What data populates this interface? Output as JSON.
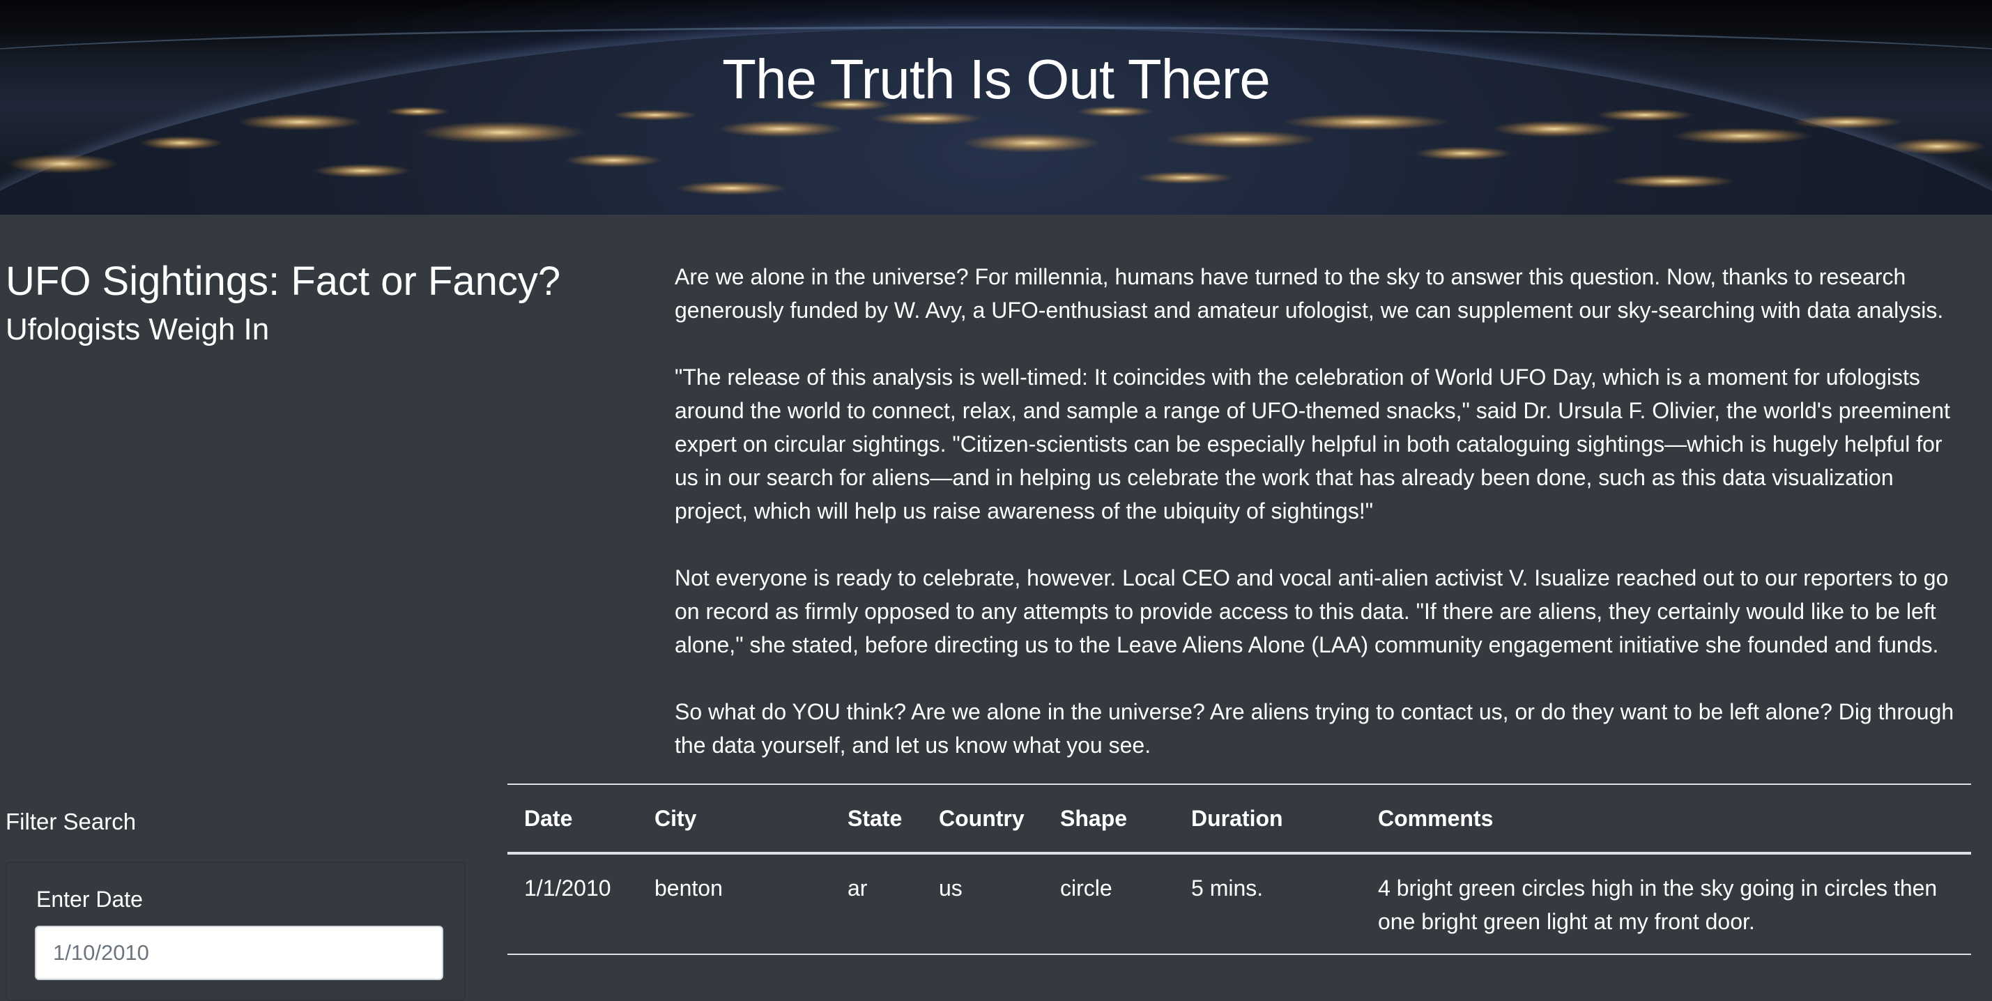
{
  "hero": {
    "title": "The Truth Is Out There"
  },
  "article": {
    "title": "UFO Sightings: Fact or Fancy?",
    "subtitle": "Ufologists Weigh In",
    "paragraphs": [
      "Are we alone in the universe? For millennia, humans have turned to the sky to answer this question. Now, thanks to research generously funded by W. Avy, a UFO-enthusiast and amateur ufologist, we can supplement our sky-searching with data analysis.",
      "\"The release of this analysis is well-timed: It coincides with the celebration of World UFO Day, which is a moment for ufologists around the world to connect, relax, and sample a range of UFO-themed snacks,\" said Dr. Ursula F. Olivier, the world's preeminent expert on circular sightings. \"Citizen-scientists can be especially helpful in both cataloguing sightings—which is hugely helpful for us in our search for aliens—and in helping us celebrate the work that has already been done, such as this data visualization project, which will help us raise awareness of the ubiquity of sightings!\"",
      "Not everyone is ready to celebrate, however. Local CEO and vocal anti-alien activist V. Isualize reached out to our reporters to go on record as firmly opposed to any attempts to provide access to this data. \"If there are aliens, they certainly would like to be left alone,\" she stated, before directing us to the Leave Aliens Alone (LAA) community engagement initiative she founded and funds.",
      "So what do YOU think? Are we alone in the universe? Are aliens trying to contact us, or do they want to be left alone? Dig through the data yourself, and let us know what you see."
    ]
  },
  "filter": {
    "heading": "Filter Search",
    "date_label": "Enter Date",
    "date_placeholder": "1/10/2010"
  },
  "table": {
    "headers": [
      "Date",
      "City",
      "State",
      "Country",
      "Shape",
      "Duration",
      "Comments"
    ],
    "rows": [
      [
        "1/1/2010",
        "benton",
        "ar",
        "us",
        "circle",
        "5 mins.",
        "4 bright green circles high in the sky going in circles then one bright green light at my front door."
      ]
    ]
  }
}
